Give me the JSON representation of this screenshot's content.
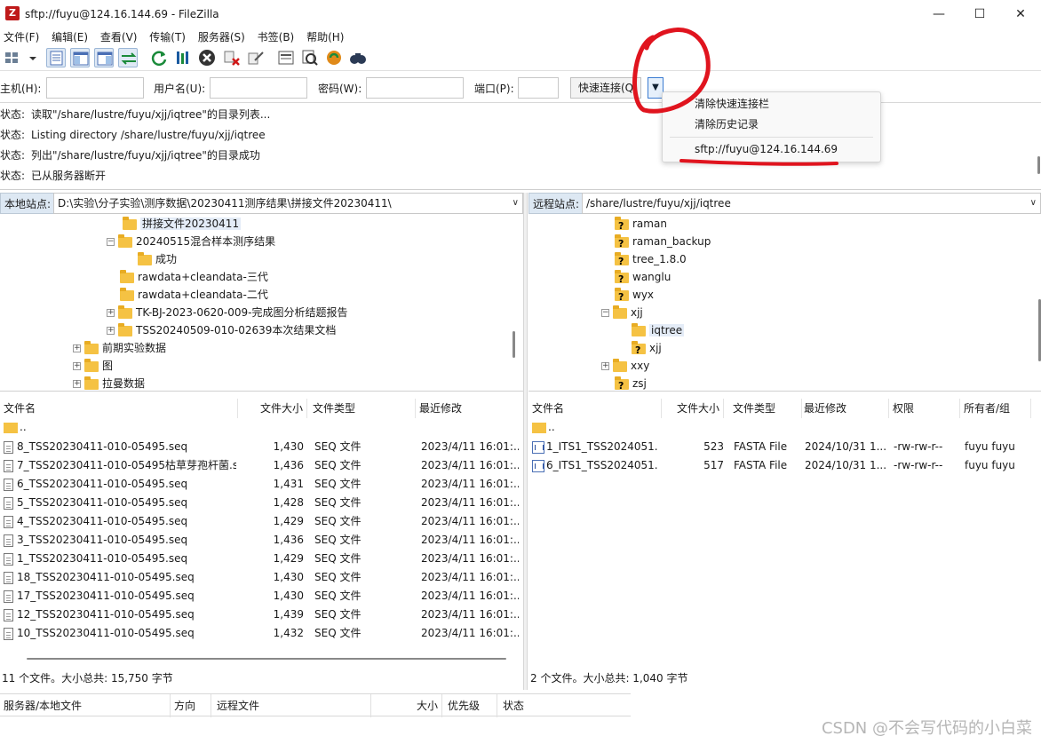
{
  "window": {
    "title": "sftp://fuyu@124.16.144.69 - FileZilla",
    "app_icon_letter": "Z",
    "controls": {
      "minimize": "—",
      "maximize": "☐",
      "close": "✕"
    }
  },
  "menubar": {
    "items": [
      "文件(F)",
      "编辑(E)",
      "查看(V)",
      "传输(T)",
      "服务器(S)",
      "书签(B)",
      "帮助(H)"
    ]
  },
  "toolbar": {
    "icons": [
      "site-manager-icon",
      "site-dropdown-icon",
      "message-log-toggle-icon",
      "local-tree-toggle-icon",
      "remote-tree-toggle-icon",
      "transfer-queue-toggle-icon",
      "refresh-icon",
      "process-queue-icon",
      "cancel-icon",
      "disconnect-icon",
      "reconnect-icon",
      "filter-icon",
      "compare-icon",
      "sync-browse-icon",
      "search-icon"
    ]
  },
  "quickconnect": {
    "host_label": "主机(H):",
    "host_value": "",
    "user_label": "用户名(U):",
    "user_value": "",
    "pass_label": "密码(W):",
    "pass_value": "",
    "port_label": "端口(P):",
    "port_value": "",
    "connect_button": "快速连接(Q)",
    "dropdown_arrow": "▼"
  },
  "dropdown_menu": {
    "items": [
      "清除快速连接栏",
      "清除历史记录"
    ],
    "history": [
      "sftp://fuyu@124.16.144.69"
    ]
  },
  "message_log": [
    {
      "key": "状态:",
      "text": "读取\"/share/lustre/fuyu/xjj/iqtree\"的目录列表..."
    },
    {
      "key": "状态:",
      "text": "Listing directory /share/lustre/fuyu/xjj/iqtree"
    },
    {
      "key": "状态:",
      "text": "列出\"/share/lustre/fuyu/xjj/iqtree\"的目录成功"
    },
    {
      "key": "状态:",
      "text": "已从服务器断开"
    }
  ],
  "local": {
    "site_label": "本地站点:",
    "path": "D:\\实验\\分子实验\\测序数据\\20230411测序结果\\拼接文件20230411\\",
    "tree": [
      {
        "label": "拼接文件20230411",
        "expander": "",
        "selected": true
      },
      {
        "label": "20240515混合样本测序结果",
        "expander": "−",
        "selected": false
      },
      {
        "label": "成功",
        "expander": "",
        "selected": false
      },
      {
        "label": "rawdata+cleandata-三代",
        "expander": "",
        "selected": false
      },
      {
        "label": "rawdata+cleandata-二代",
        "expander": "",
        "selected": false
      },
      {
        "label": "TK-BJ-2023-0620-009-完成图分析结题报告",
        "expander": "+",
        "selected": false
      },
      {
        "label": "TSS20240509-010-02639本次结果文档",
        "expander": "+",
        "selected": false
      },
      {
        "label": "前期实验数据",
        "expander": "+",
        "selected": false
      },
      {
        "label": "图",
        "expander": "+",
        "selected": false
      },
      {
        "label": "拉曼数据",
        "expander": "+",
        "selected": false
      }
    ],
    "columns": [
      "文件名",
      "文件大小",
      "文件类型",
      "最近修改"
    ],
    "parent_dir": "..",
    "files": [
      {
        "name": "8_TSS20230411-010-05495.seq",
        "size": "1,430",
        "type": "SEQ 文件",
        "modified": "2023/4/11 16:01:..."
      },
      {
        "name": "7_TSS20230411-010-05495枯草芽孢杆菌.s...",
        "size": "1,436",
        "type": "SEQ 文件",
        "modified": "2023/4/11 16:01:..."
      },
      {
        "name": "6_TSS20230411-010-05495.seq",
        "size": "1,431",
        "type": "SEQ 文件",
        "modified": "2023/4/11 16:01:..."
      },
      {
        "name": "5_TSS20230411-010-05495.seq",
        "size": "1,428",
        "type": "SEQ 文件",
        "modified": "2023/4/11 16:01:..."
      },
      {
        "name": "4_TSS20230411-010-05495.seq",
        "size": "1,429",
        "type": "SEQ 文件",
        "modified": "2023/4/11 16:01:..."
      },
      {
        "name": "3_TSS20230411-010-05495.seq",
        "size": "1,436",
        "type": "SEQ 文件",
        "modified": "2023/4/11 16:01:..."
      },
      {
        "name": "1_TSS20230411-010-05495.seq",
        "size": "1,429",
        "type": "SEQ 文件",
        "modified": "2023/4/11 16:01:..."
      },
      {
        "name": "18_TSS20230411-010-05495.seq",
        "size": "1,430",
        "type": "SEQ 文件",
        "modified": "2023/4/11 16:01:..."
      },
      {
        "name": "17_TSS20230411-010-05495.seq",
        "size": "1,430",
        "type": "SEQ 文件",
        "modified": "2023/4/11 16:01:..."
      },
      {
        "name": "12_TSS20230411-010-05495.seq",
        "size": "1,439",
        "type": "SEQ 文件",
        "modified": "2023/4/11 16:01:..."
      },
      {
        "name": "10_TSS20230411-010-05495.seq",
        "size": "1,432",
        "type": "SEQ 文件",
        "modified": "2023/4/11 16:01:..."
      }
    ],
    "status": "11 个文件。大小总共: 15,750 字节"
  },
  "remote": {
    "site_label": "远程站点:",
    "path": "/share/lustre/fuyu/xjj/iqtree",
    "tree": [
      {
        "label": "raman",
        "expander": "",
        "selected": false
      },
      {
        "label": "raman_backup",
        "expander": "",
        "selected": false
      },
      {
        "label": "tree_1.8.0",
        "expander": "",
        "selected": false
      },
      {
        "label": "wanglu",
        "expander": "",
        "selected": false
      },
      {
        "label": "wyx",
        "expander": "",
        "selected": false
      },
      {
        "label": "xjj",
        "expander": "−",
        "selected": false
      },
      {
        "label": "iqtree",
        "expander": "",
        "selected": true
      },
      {
        "label": "xjj",
        "expander": "",
        "selected": false
      },
      {
        "label": "xxy",
        "expander": "+",
        "selected": false
      },
      {
        "label": "zsj",
        "expander": "",
        "selected": false
      }
    ],
    "columns": [
      "文件名",
      "文件大小",
      "文件类型",
      "最近修改",
      "权限",
      "所有者/组"
    ],
    "parent_dir": "..",
    "files": [
      {
        "name": "1_ITS1_TSS2024051...",
        "size": "523",
        "type": "FASTA File",
        "modified": "2024/10/31 1...",
        "perm": "-rw-rw-r--",
        "owner": "fuyu fuyu"
      },
      {
        "name": "6_ITS1_TSS2024051...",
        "size": "517",
        "type": "FASTA File",
        "modified": "2024/10/31 1...",
        "perm": "-rw-rw-r--",
        "owner": "fuyu fuyu"
      }
    ],
    "status": "2 个文件。大小总共: 1,040 字节"
  },
  "queue": {
    "columns": [
      "服务器/本地文件",
      "方向",
      "远程文件",
      "大小",
      "优先级",
      "状态"
    ]
  },
  "watermark": "CSDN @不会写代码的小白菜",
  "colors": {
    "annotation_red": "#e0141e",
    "selection_blue": "#e4ecf7",
    "folder_yellow": "#f5c243"
  }
}
